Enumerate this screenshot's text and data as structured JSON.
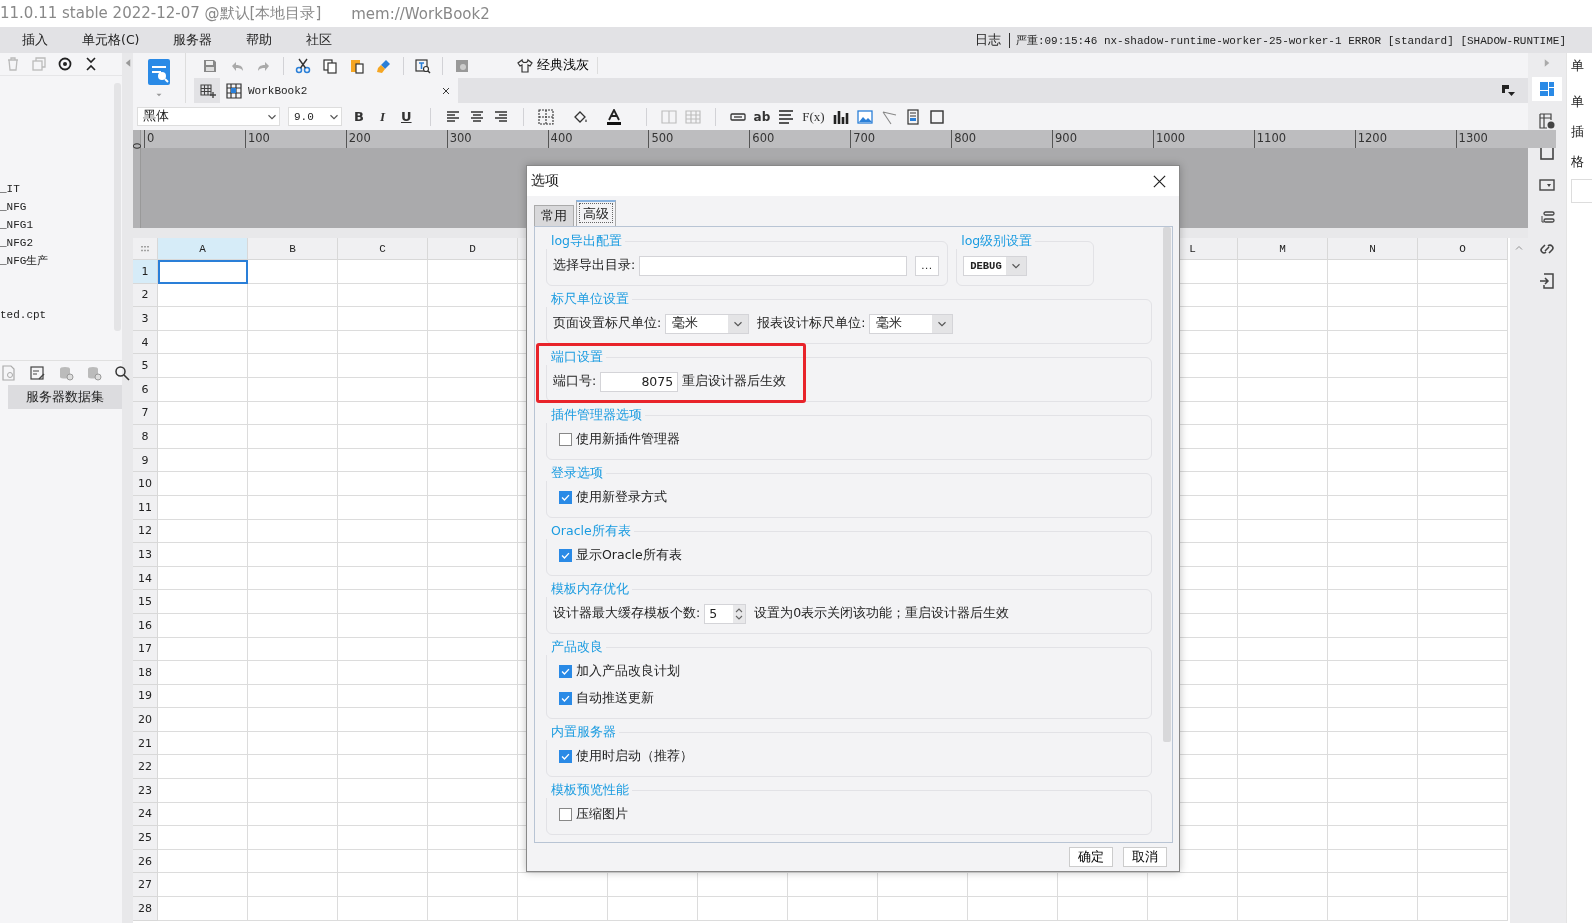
{
  "window": {
    "title": "11.0.11 stable 2022-12-07 @默认[本地目录]",
    "path": "mem://WorkBook2"
  },
  "menu": [
    {
      "label": "插入"
    },
    {
      "label": "单元格(C)"
    },
    {
      "label": "服务器"
    },
    {
      "label": "帮助"
    },
    {
      "label": "社区"
    }
  ],
  "log_bar": {
    "label": "日志",
    "message": "严重:09:15:46 nx-shadow-runtime-worker-25-worker-1 ERROR [standard] [SHADOW-RUNTIME]"
  },
  "left_panel": {
    "tree": [
      "_IT",
      "_NFG",
      "_NFG1",
      "_NFG2",
      "_NFG生产",
      "ted.cpt"
    ],
    "tab": "服务器数据集"
  },
  "toolbar": {
    "theme_button": "经典浅灰"
  },
  "document_tab": {
    "label": "WorkBook2"
  },
  "format_bar": {
    "font": "黑体",
    "size": "9.0",
    "style_buttons": [
      "B",
      "I",
      "U"
    ],
    "text_button": "ab",
    "formula_button": "F(x)"
  },
  "ruler": {
    "marks": [
      "0",
      "100",
      "200",
      "300",
      "400",
      "500",
      "600",
      "700",
      "800",
      "900",
      "1000",
      "1100",
      "1200",
      "1300"
    ],
    "vertical_mark": "0"
  },
  "sheet": {
    "columns_left": [
      {
        "label": "A",
        "selected": true
      },
      {
        "label": "B",
        "selected": false
      },
      {
        "label": "C",
        "selected": false
      },
      {
        "label": "D",
        "selected": false
      }
    ],
    "columns_right": [
      {
        "label": "L",
        "selected": false
      },
      {
        "label": "M",
        "selected": false
      },
      {
        "label": "N",
        "selected": false
      },
      {
        "label": "O",
        "selected": false
      }
    ],
    "rows": [
      {
        "label": "1",
        "selected": true
      },
      {
        "label": "2",
        "selected": false
      },
      {
        "label": "3",
        "selected": false
      },
      {
        "label": "4",
        "selected": false
      },
      {
        "label": "5",
        "selected": false
      },
      {
        "label": "6",
        "selected": false
      },
      {
        "label": "7",
        "selected": false
      },
      {
        "label": "8",
        "selected": false
      },
      {
        "label": "9",
        "selected": false
      },
      {
        "label": "10",
        "selected": false
      },
      {
        "label": "11",
        "selected": false
      },
      {
        "label": "12",
        "selected": false
      },
      {
        "label": "13",
        "selected": false
      },
      {
        "label": "14",
        "selected": false
      },
      {
        "label": "15",
        "selected": false
      },
      {
        "label": "16",
        "selected": false
      },
      {
        "label": "17",
        "selected": false
      },
      {
        "label": "18",
        "selected": false
      },
      {
        "label": "19",
        "selected": false
      },
      {
        "label": "20",
        "selected": false
      },
      {
        "label": "21",
        "selected": false
      },
      {
        "label": "22",
        "selected": false
      },
      {
        "label": "23",
        "selected": false
      },
      {
        "label": "24",
        "selected": false
      },
      {
        "label": "25",
        "selected": false
      },
      {
        "label": "26",
        "selected": false
      },
      {
        "label": "27",
        "selected": false
      },
      {
        "label": "28",
        "selected": false
      }
    ]
  },
  "right_panel": {
    "labels": [
      "单",
      "单",
      "插",
      "格"
    ]
  },
  "dialog": {
    "title": "选项",
    "tabs": [
      {
        "label": "常用",
        "selected": false
      },
      {
        "label": "高级",
        "selected": true
      }
    ],
    "sections": [
      {
        "kind": "log",
        "title": "log导出配置",
        "label": "选择导出目录:",
        "browse": "...",
        "level_title": "log级别设置",
        "level": "DEBUG"
      },
      {
        "kind": "units",
        "title": "标尺单位设置",
        "fields": [
          {
            "label": "页面设置标尺单位:",
            "value": "毫米"
          },
          {
            "label": "报表设计标尺单位:",
            "value": "毫米"
          }
        ]
      },
      {
        "kind": "port",
        "title": "端口设置",
        "label": "端口号:",
        "value": "8075",
        "note": "重启设计器后生效",
        "highlighted": true
      },
      {
        "kind": "checks",
        "title": "插件管理器选项",
        "items": [
          {
            "label": "使用新插件管理器",
            "checked": false
          }
        ]
      },
      {
        "kind": "checks",
        "title": "登录选项",
        "items": [
          {
            "label": "使用新登录方式",
            "checked": true
          }
        ]
      },
      {
        "kind": "checks",
        "title": "Oracle所有表",
        "items": [
          {
            "label": "显示Oracle所有表",
            "checked": true
          }
        ]
      },
      {
        "kind": "spinner",
        "title": "模板内存优化",
        "label": "设计器最大缓存模板个数:",
        "value": "5",
        "note": "设置为0表示关闭该功能；重启设计器后生效"
      },
      {
        "kind": "checks",
        "title": "产品改良",
        "items": [
          {
            "label": "加入产品改良计划",
            "checked": true
          },
          {
            "label": "自动推送更新",
            "checked": true
          }
        ]
      },
      {
        "kind": "checks",
        "title": "内置服务器",
        "items": [
          {
            "label": "使用时启动（推荐）",
            "checked": true
          }
        ]
      },
      {
        "kind": "checks",
        "title": "模板预览性能",
        "items": [
          {
            "label": "压缩图片",
            "checked": false
          }
        ]
      }
    ],
    "buttons": [
      "确定",
      "取消"
    ]
  }
}
